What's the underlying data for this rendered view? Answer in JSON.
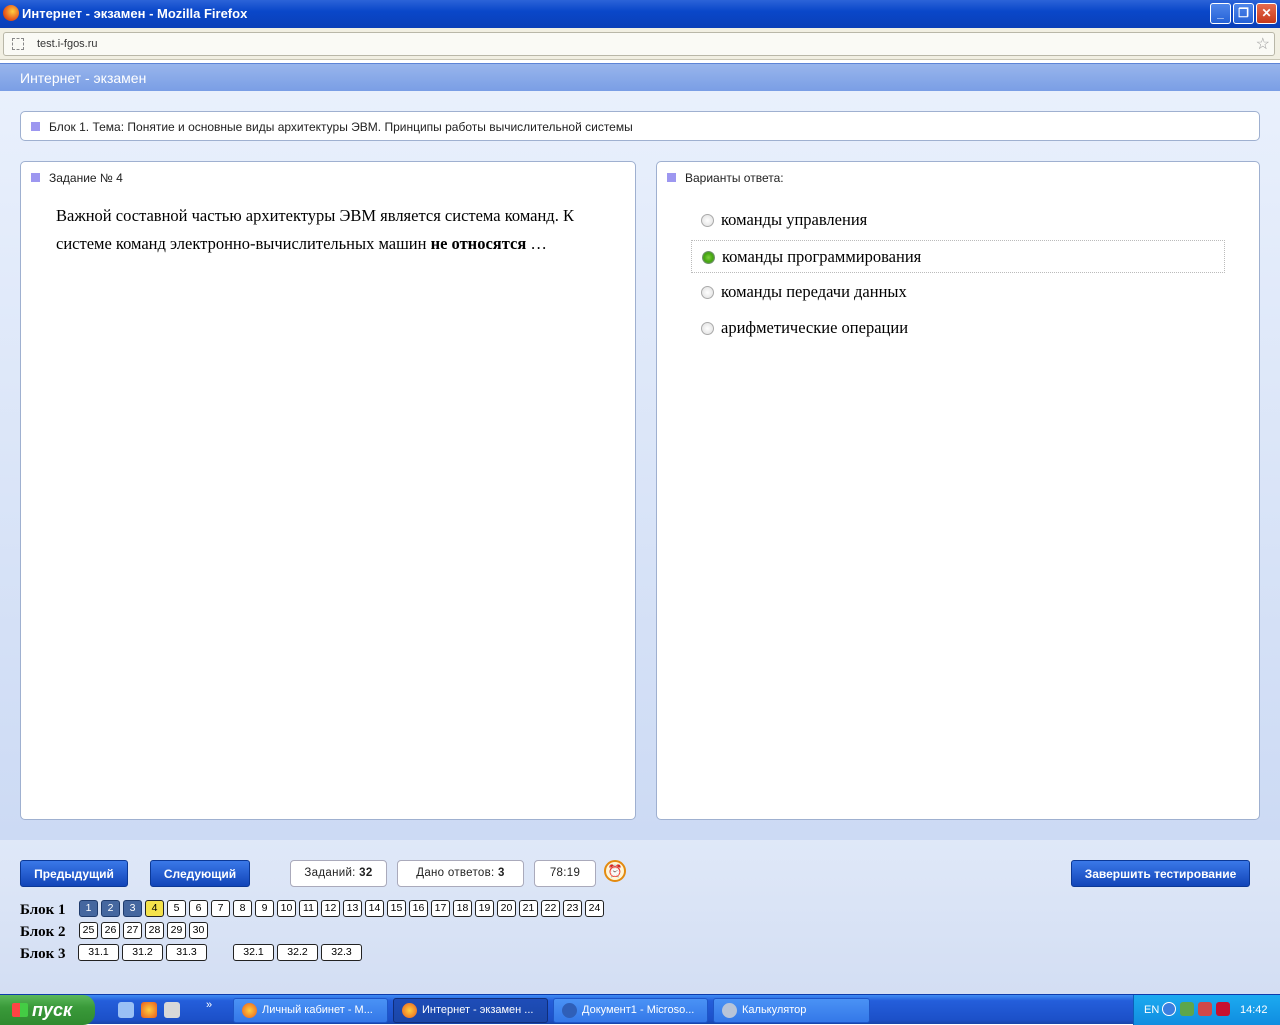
{
  "window": {
    "title": "Интернет - экзамен - Mozilla Firefox",
    "min": "_",
    "max": "❐",
    "close": "✕"
  },
  "address": {
    "url": "test.i-fgos.ru",
    "star": "☆"
  },
  "app": {
    "title": "Интернет - экзамен"
  },
  "block_header": "Блок 1. Тема: Понятие и основные виды архитектуры ЭВМ. Принципы работы вычислительной системы",
  "task": {
    "heading": "Задание № 4",
    "text_part1": "Важной составной частью архитектуры ЭВМ является система команд. К системе команд электронно-вычислительных машин",
    "text_bold": "не относятся",
    "text_end": " …"
  },
  "answers": {
    "heading": "Варианты ответа:",
    "options": [
      {
        "label": "команды управления",
        "selected": false
      },
      {
        "label": "команды программирования",
        "selected": true
      },
      {
        "label": "команды передачи данных",
        "selected": false
      },
      {
        "label": "арифметические операции",
        "selected": false
      }
    ]
  },
  "controls": {
    "prev": "Предыдущий",
    "next": "Следующий",
    "tasks_label": "Заданий:",
    "tasks_count": "32",
    "answered_label": "Дано ответов:",
    "answered_count": "3",
    "timer": "78:19",
    "finish": "Завершить тестирование"
  },
  "blocks": [
    {
      "label": "Блок 1",
      "items": [
        "1",
        "2",
        "3",
        "4",
        "5",
        "6",
        "7",
        "8",
        "9",
        "10",
        "11",
        "12",
        "13",
        "14",
        "15",
        "16",
        "17",
        "18",
        "19",
        "20",
        "21",
        "22",
        "23",
        "24"
      ],
      "done": [
        "1",
        "2",
        "3"
      ],
      "current": "4"
    },
    {
      "label": "Блок 2",
      "items": [
        "25",
        "26",
        "27",
        "28",
        "29",
        "30"
      ],
      "done": [],
      "current": ""
    },
    {
      "label": "Блок 3",
      "items": [
        "31.1",
        "31.2",
        "31.3",
        "32.1",
        "32.2",
        "32.3"
      ],
      "done": [],
      "current": ""
    }
  ],
  "taskbar": {
    "start": "пуск",
    "more": "»",
    "buttons": [
      {
        "label": "Личный кабинет - М...",
        "active": false
      },
      {
        "label": "Интернет - экзамен ...",
        "active": true
      },
      {
        "label": "Документ1 - Microso...",
        "active": false
      },
      {
        "label": "Калькулятор",
        "active": false
      }
    ],
    "lang": "EN",
    "time": "14:42"
  }
}
